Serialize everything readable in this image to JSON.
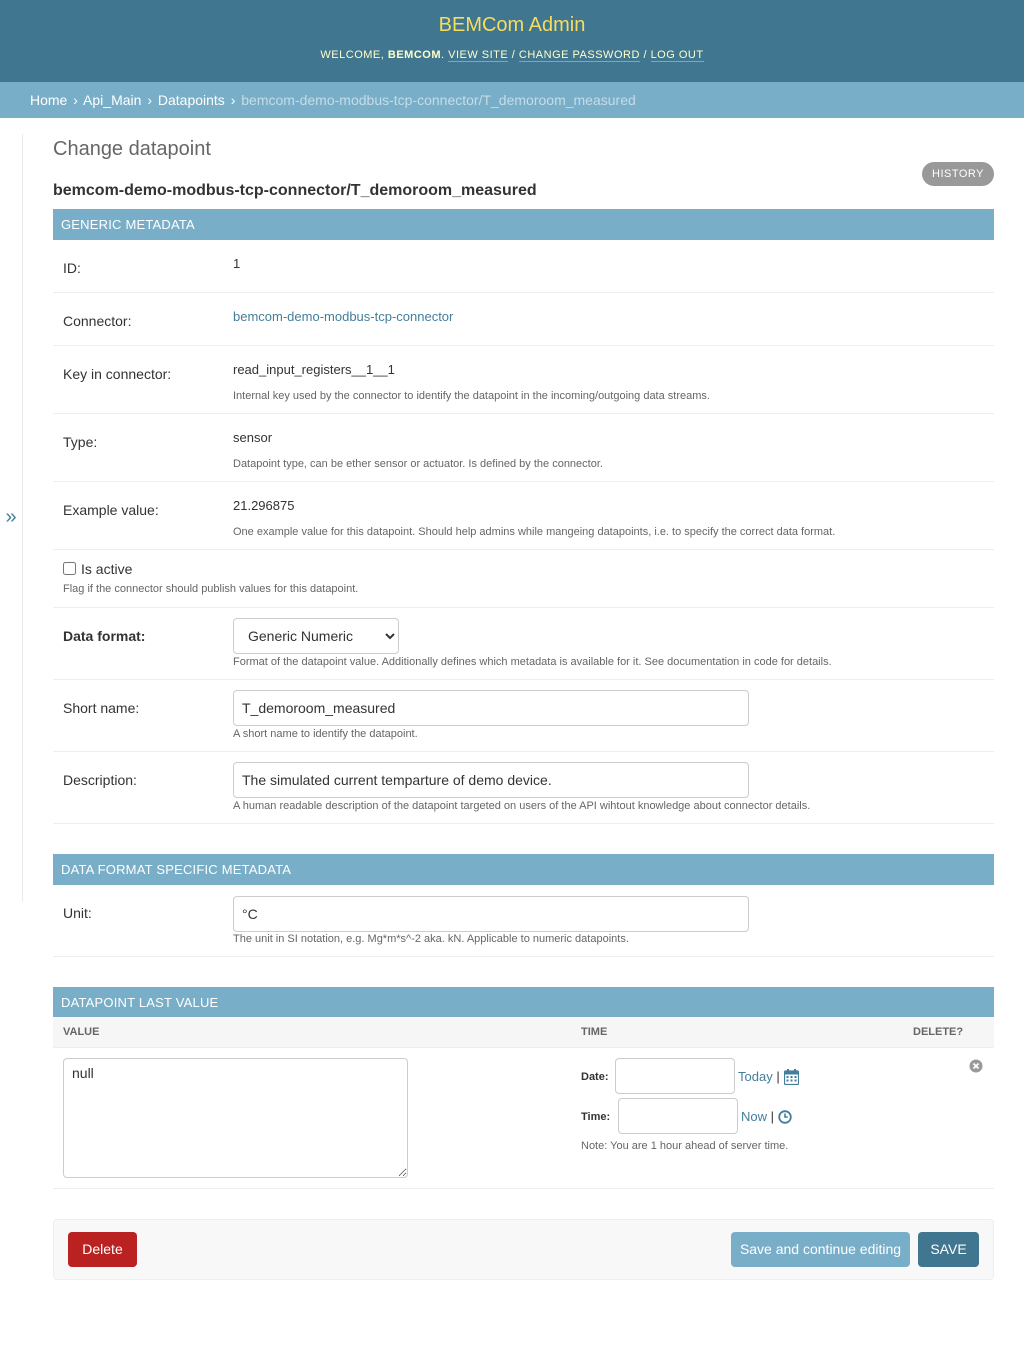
{
  "header": {
    "branding": "BEMCom Admin",
    "welcome": "WELCOME, ",
    "username": "BEMCOM",
    "view_site": "VIEW SITE",
    "change_password": "CHANGE PASSWORD",
    "log_out": "LOG OUT",
    "sep": " / "
  },
  "breadcrumbs": {
    "home": "Home",
    "app": "Api_Main",
    "model": "Datapoints",
    "current": "bemcom-demo-modbus-tcp-connector/T_demoroom_measured",
    "sep": "›"
  },
  "nav_toggle": "»",
  "content_title": "Change datapoint",
  "object_title": "bemcom-demo-modbus-tcp-connector/T_demoroom_measured",
  "history_label": "HISTORY",
  "generic": {
    "heading": "GENERIC METADATA",
    "id_label": "ID:",
    "id_value": "1",
    "connector_label": "Connector:",
    "connector_value": "bemcom-demo-modbus-tcp-connector",
    "key_label": "Key in connector:",
    "key_value": "read_input_registers__1__1",
    "key_help": "Internal key used by the connector to identify the datapoint in the incoming/outgoing data streams.",
    "type_label": "Type:",
    "type_value": "sensor",
    "type_help": "Datapoint type, can be ether sensor or actuator. Is defined by the connector.",
    "example_label": "Example value:",
    "example_value": "21.296875",
    "example_help": "One example value for this datapoint. Should help admins while mangeing datapoints, i.e. to specify the correct data format.",
    "active_label": "Is active",
    "active_checked": false,
    "active_help": "Flag if the connector should publish values for this datapoint.",
    "format_label": "Data format:",
    "format_value": "Generic Numeric",
    "format_help": "Format of the datapoint value. Additionally defines which metadata is available for it. See documentation in code for details.",
    "short_name_label": "Short name:",
    "short_name_value": "T_demoroom_measured",
    "short_name_help": "A short name to identify the datapoint.",
    "description_label": "Description:",
    "description_value": "The simulated current temparture of demo device.",
    "description_help": "A human readable description of the datapoint targeted on users of the API wihtout knowledge about connector details."
  },
  "specific": {
    "heading": "DATA FORMAT SPECIFIC METADATA",
    "unit_label": "Unit:",
    "unit_value": "°C",
    "unit_help": "The unit in SI notation, e.g. Mg*m*s^-2 aka. kN. Applicable to numeric datapoints."
  },
  "last_value": {
    "heading": "DATAPOINT LAST VALUE",
    "col_value": "VALUE",
    "col_time": "TIME",
    "col_delete": "DELETE?",
    "value": "null",
    "date_label": "Date:",
    "date_value": "",
    "today": "Today",
    "time_label": "Time:",
    "time_value": "",
    "now": "Now",
    "pipe": "|",
    "tz_note": "Note: You are 1 hour ahead of server time."
  },
  "submit": {
    "delete": "Delete",
    "save_continue": "Save and continue editing",
    "save": "SAVE"
  },
  "colors": {
    "header_bg": "#417690",
    "branding": "#f5dd5d",
    "module_bg": "#79aec8",
    "link": "#447e9b",
    "delete_bg": "#ba2121",
    "save_bg": "#417690",
    "save_continue_bg": "#79aec8"
  }
}
